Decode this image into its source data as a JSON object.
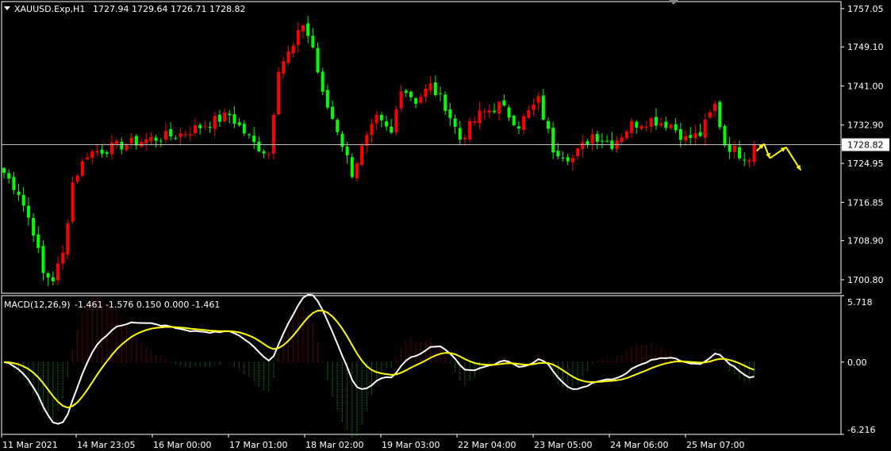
{
  "chart_data": [
    {
      "type": "candlestick",
      "title": "XAUUSD.Exp,H1",
      "ohlc_header": "1727.94 1729.64 1726.71 1728.82",
      "current_price": 1728.82,
      "current_price_label": "1728.82",
      "ylim": [
        1698.0,
        1758.5
      ],
      "y_ticks": [
        {
          "value": 1757.05,
          "label": "1757.05"
        },
        {
          "value": 1749.1,
          "label": "1749.10"
        },
        {
          "value": 1741.0,
          "label": "1741.00"
        },
        {
          "value": 1732.9,
          "label": "1732.90"
        },
        {
          "value": 1724.95,
          "label": "1724.95"
        },
        {
          "value": 1716.85,
          "label": "1716.85"
        },
        {
          "value": 1708.9,
          "label": "1708.90"
        },
        {
          "value": 1700.8,
          "label": "1700.80"
        }
      ],
      "x_ticks": [
        "11 Mar 2021",
        "14 Mar 23:05",
        "16 Mar 00:00",
        "17 Mar 01:00",
        "18 Mar 02:00",
        "19 Mar 03:00",
        "22 Mar 04:00",
        "23 Mar 05:00",
        "24 Mar 06:00",
        "25 Mar 07:00"
      ],
      "close_path": [
        [
          0,
          1723
        ],
        [
          3,
          1719
        ],
        [
          6,
          1711
        ],
        [
          8,
          1702
        ],
        [
          10,
          1701
        ],
        [
          12,
          1706
        ],
        [
          14,
          1721
        ],
        [
          17,
          1727
        ],
        [
          21,
          1728
        ],
        [
          25,
          1729
        ],
        [
          30,
          1730
        ],
        [
          36,
          1731
        ],
        [
          41,
          1733
        ],
        [
          46,
          1735
        ],
        [
          51,
          1729
        ],
        [
          54,
          1727
        ],
        [
          56,
          1745
        ],
        [
          59,
          1749
        ],
        [
          61,
          1754
        ],
        [
          63,
          1749
        ],
        [
          65,
          1739
        ],
        [
          68,
          1732
        ],
        [
          71,
          1723
        ],
        [
          73,
          1728
        ],
        [
          76,
          1734
        ],
        [
          79,
          1731
        ],
        [
          81,
          1741
        ],
        [
          84,
          1738
        ],
        [
          87,
          1741
        ],
        [
          90,
          1737
        ],
        [
          93,
          1730
        ],
        [
          97,
          1735
        ],
        [
          101,
          1737
        ],
        [
          105,
          1733
        ],
        [
          109,
          1738
        ],
        [
          112,
          1728
        ],
        [
          116,
          1726
        ],
        [
          120,
          1731
        ],
        [
          124,
          1729
        ],
        [
          128,
          1733
        ],
        [
          132,
          1734
        ],
        [
          136,
          1733
        ],
        [
          139,
          1730
        ],
        [
          142,
          1731
        ],
        [
          145,
          1737
        ],
        [
          147,
          1729
        ],
        [
          150,
          1727
        ],
        [
          153,
          1726
        ]
      ],
      "candle_count": 154,
      "projection_arrows": [
        [
          [
            153.5,
            1727.5
          ],
          [
            155.0,
            1729.0
          ],
          [
            156.2,
            1726.0
          ],
          [
            159.5,
            1728.3
          ],
          [
            162.5,
            1723.5
          ]
        ]
      ]
    },
    {
      "type": "macd",
      "title": "MACD(12,26,9)",
      "values_header": "-1.461 -1.576 0.150 0.000 -1.461",
      "params": {
        "fast": 12,
        "slow": 26,
        "signal": 9
      },
      "ylim": [
        -6.216,
        5.718
      ],
      "y_ticks": [
        {
          "value": 5.718,
          "label": "5.718"
        },
        {
          "value": 0.0,
          "label": "0.00"
        },
        {
          "value": -6.216,
          "label": "-6.216"
        }
      ],
      "series": [
        {
          "color": "#ffffff"
        },
        {
          "color": "#ffff00"
        }
      ]
    }
  ],
  "colors": {
    "background": "#000000",
    "grid_frame": "#ffffff",
    "bull_candle": "#ff0000",
    "bear_candle": "#00ff00",
    "current_line": "#c0c0c0",
    "arrow": "#ffff00",
    "histogram_pos": "#aa0000",
    "histogram_neg": "#00aa00"
  }
}
